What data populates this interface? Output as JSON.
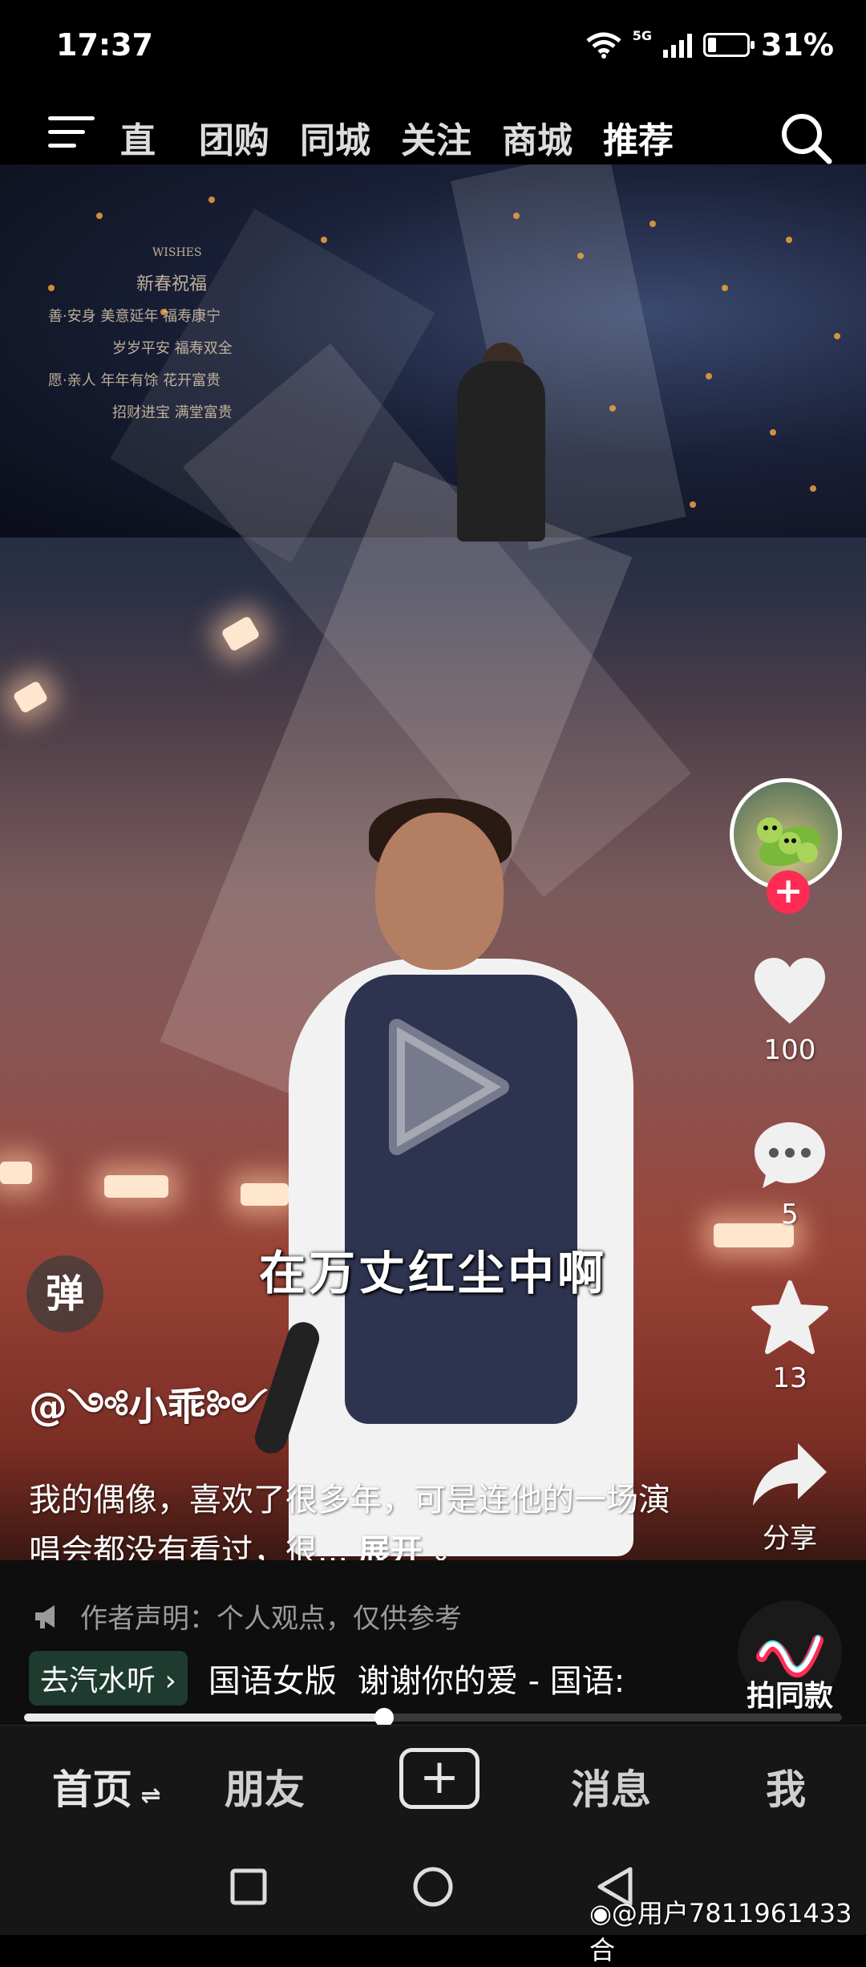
{
  "status_bar": {
    "time": "17:37",
    "network": "5G",
    "battery": "31%",
    "battery_fraction": 0.31
  },
  "top_nav": {
    "tabs": [
      {
        "label": "直播",
        "active": false
      },
      {
        "label": "团购",
        "active": false
      },
      {
        "label": "同城",
        "active": false
      },
      {
        "label": "关注",
        "active": false
      },
      {
        "label": "商城",
        "active": false
      },
      {
        "label": "推荐",
        "active": true
      }
    ],
    "menu_icon": "hamburger-icon",
    "search_icon": "search-icon"
  },
  "video": {
    "subtitle": "在万丈红尘中啊",
    "poster_text": [
      "WISHES",
      "新春祝福",
      "善·安身  美意延年  福寿康宁",
      "岁岁平安  福寿双全",
      "愿·亲人  年年有馀  花开富贵",
      "招财进宝  满堂富贵"
    ],
    "progress_fraction": 0.44
  },
  "actions": {
    "like_count": "100",
    "comment_count": "5",
    "favorite_count": "13",
    "share_label": "分享",
    "follow_symbol": "+"
  },
  "danmu_label": "弹",
  "author": "@༺小乖༻",
  "description": {
    "text": "我的偶像，喜欢了很多年，可是连他的一场演唱会都没有看过，很...",
    "expand_label": "展开"
  },
  "notice": "作者声明：个人观点，仅供参考",
  "music": {
    "qishui_label": "去汽水听",
    "tag": "国语女版",
    "title": "谢谢你的爱 - 国语:"
  },
  "paitongkuan_label": "拍同款",
  "bottom_nav": {
    "home": "首页",
    "friends": "朋友",
    "add": "+",
    "messages": "消息",
    "me": "我"
  },
  "watermark": "@用户7811961433合",
  "colors": {
    "accent": "#fe2c55",
    "qishui_bg": "#1f3a2e"
  }
}
